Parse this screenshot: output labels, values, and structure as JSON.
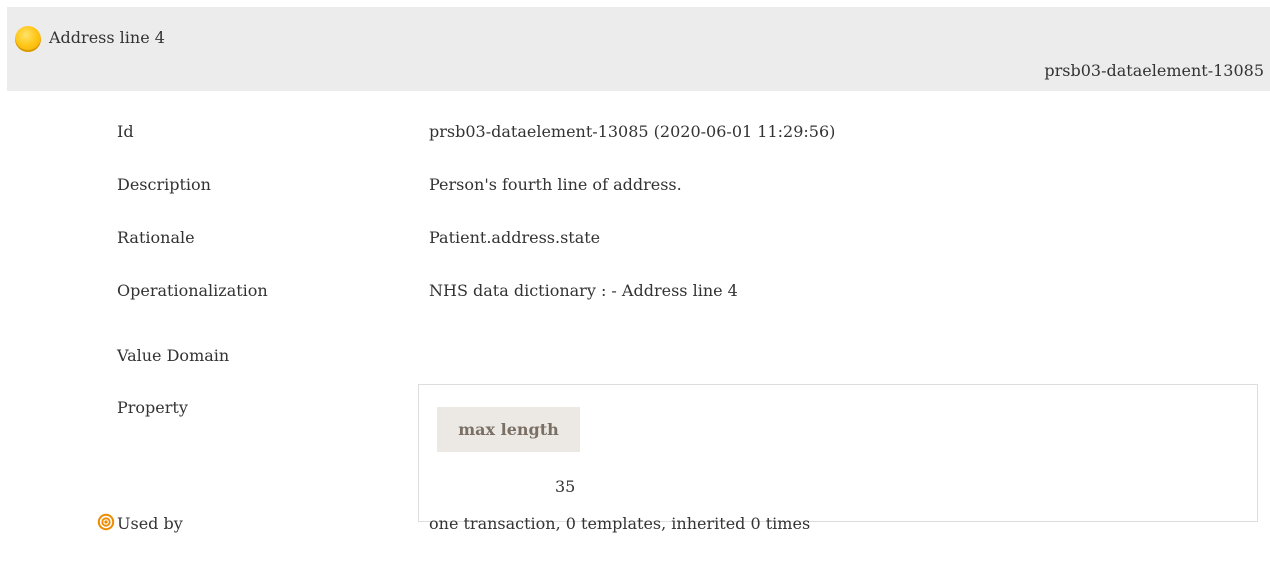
{
  "header": {
    "title": "Address line 4",
    "id": "prsb03-dataelement-13085",
    "status_color": "#ffc71a"
  },
  "fields": {
    "id": {
      "label": "Id",
      "value": "prsb03-dataelement-13085 (2020-06-01 11:29:56)"
    },
    "description": {
      "label": "Description",
      "value": "Person's fourth line of address."
    },
    "rationale": {
      "label": "Rationale",
      "value": "Patient.address.state"
    },
    "operationalization": {
      "label": "Operationalization",
      "value": "NHS data dictionary : - Address line 4"
    },
    "value_domain": {
      "label": "Value Domain"
    },
    "property": {
      "label": "Property",
      "column_header": "max length",
      "column_value": "35"
    },
    "used_by": {
      "label": "Used by",
      "value": "one transaction, 0 templates, inherited 0 times",
      "icon": "target-icon",
      "icon_color": "#f08a00"
    }
  }
}
